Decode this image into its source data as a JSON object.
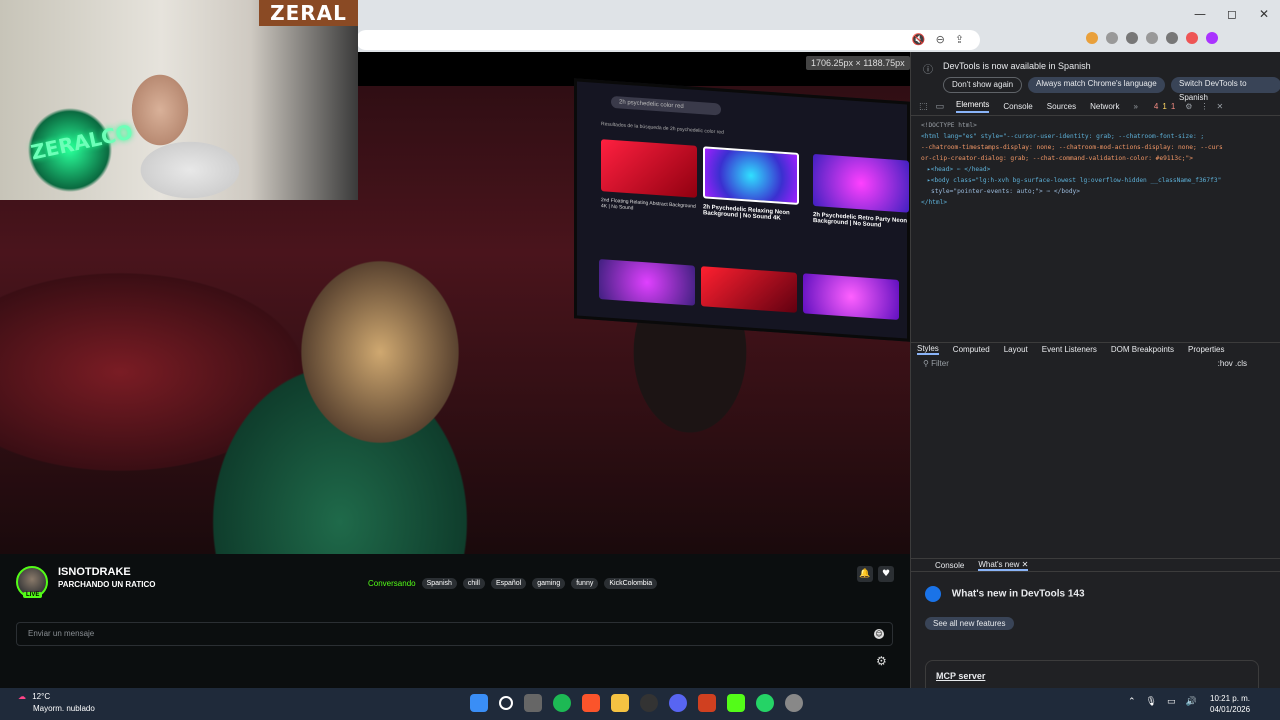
{
  "browser": {
    "window_controls": [
      "—",
      "◻",
      "✕"
    ]
  },
  "video": {
    "dimensions_label": "1706.25px × 1188.75px",
    "tv_search_text": "2h psychedelic color red",
    "tv_results_title": "Resultados de la búsqueda de 2h psychedelic color red",
    "tv_video_titles": [
      "2nd Floating Relating Abstract Background 4K | No Sound",
      "2h Psychedelic Relaxing Neon Background | No Sound 4K",
      "2h Psychedelic Retro Party Neon Background | No Sound"
    ]
  },
  "webcam": {
    "logo": "ZERAL",
    "neon_sign": "ZERALCO"
  },
  "stream": {
    "streamer_name": "ISNOTDRAKE",
    "stream_title": "PARCHANDO UN RATICO",
    "live_badge": "LIVE",
    "category": "Conversando",
    "tags": [
      "Spanish",
      "chill",
      "Español",
      "gaming",
      "funny",
      "KickColombia"
    ],
    "chat_placeholder": "Enviar un mensaje"
  },
  "devtools": {
    "banner_message": "DevTools is now available in Spanish",
    "banner_buttons": [
      "Don't show again",
      "Always match Chrome's language",
      "Switch DevTools to Spanish"
    ],
    "tabs": [
      "Elements",
      "Console",
      "Sources",
      "Network"
    ],
    "error_count": "4",
    "warning_count": "1",
    "issue_count": "1",
    "code_lines": {
      "doctype": "<!DOCTYPE html>",
      "html_open": "<html lang=\"es\" style=\"--cursor-user-identity: grab; --chatroom-font-size: ;",
      "html_cont1": "--chatroom-timestamps-display: none; --chatroom-mod-actions-display: none; --curs",
      "html_cont2": "or-clip-creator-dialog: grab; --chat-command-validation-color: #e9113c;\">",
      "head": "▸<head> ⋯ </head>",
      "body1": "▸<body class=\"lg:h-xvh bg-surface-lowest lg:overflow-hidden __className_f367f3\"",
      "body2": "style=\"pointer-events: auto;\"> ⋯ </body>",
      "html_close": "</html>"
    },
    "styles_tabs": [
      "Styles",
      "Computed",
      "Layout",
      "Event Listeners",
      "DOM Breakpoints",
      "Properties"
    ],
    "filter_placeholder": "Filter",
    "hov_cls": ":hov .cls",
    "drawer_tabs": [
      "Console",
      "What's new ✕"
    ],
    "whats_new_title": "What's new in DevTools 143",
    "see_all_label": "See all new features",
    "mcp_card": "MCP server"
  },
  "taskbar": {
    "temperature": "12°C",
    "weather": "Mayorm. nublado",
    "time": "10:21 p. m.",
    "date": "04/01/2026"
  }
}
